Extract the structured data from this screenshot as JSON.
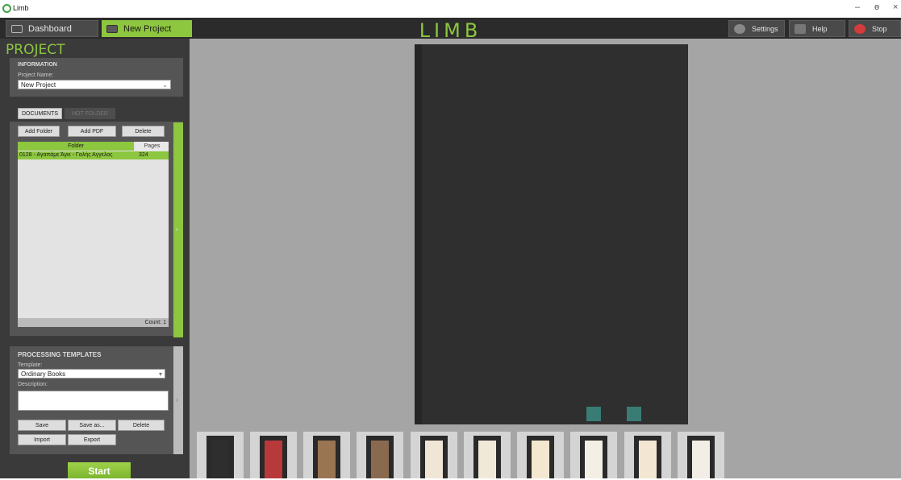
{
  "window": {
    "title": "Limb",
    "minimize": "–",
    "restore": "ɵ",
    "close": "×"
  },
  "nav": {
    "dashboard": "Dashboard",
    "new_project": "New Project"
  },
  "logo": "LIMB",
  "top_buttons": {
    "settings": "Settings",
    "help": "Help",
    "stop": "Stop"
  },
  "project": {
    "title": "PROJECT",
    "information_heading": "INFORMATION",
    "name_label": "Project Name:",
    "name_value": "New Project"
  },
  "subtabs": {
    "documents": "DOCUMENTS",
    "hot_folder": "HOT FOLDER"
  },
  "doc_buttons": {
    "add_folder": "Add Folder",
    "add_pdf": "Add PDF",
    "delete": "Delete"
  },
  "doc_table": {
    "headers": {
      "folder": "Folder",
      "pages": "Pages"
    },
    "rows": [
      {
        "folder": "0128 - Αγαπάμε Άγιε - Γαλής Αγγελος",
        "pages": "324"
      }
    ],
    "count": "Count: 1"
  },
  "processing": {
    "heading": "PROCESSING TEMPLATES",
    "template_label": "Template:",
    "template_value": "Ordinary Books",
    "description_label": "Description:",
    "buttons": {
      "save": "Save",
      "save_as": "Save as...",
      "delete": "Delete",
      "import": "Import",
      "export": "Export"
    }
  },
  "start": "Start",
  "colors": {
    "accent": "#8dc63f",
    "panel": "#3a3a3a",
    "canvas": "#a5a5a5"
  },
  "thumbnails": [
    {
      "color": "#2e2e2e"
    },
    {
      "color": "#b8393a"
    },
    {
      "color": "#9a7552"
    },
    {
      "color": "#8a6a4e"
    },
    {
      "color": "#efe6d6"
    },
    {
      "color": "#f1e9d8"
    },
    {
      "color": "#f3e7d0"
    },
    {
      "color": "#f4efe4"
    },
    {
      "color": "#f3e6d2"
    },
    {
      "color": "#f2eee6"
    }
  ]
}
